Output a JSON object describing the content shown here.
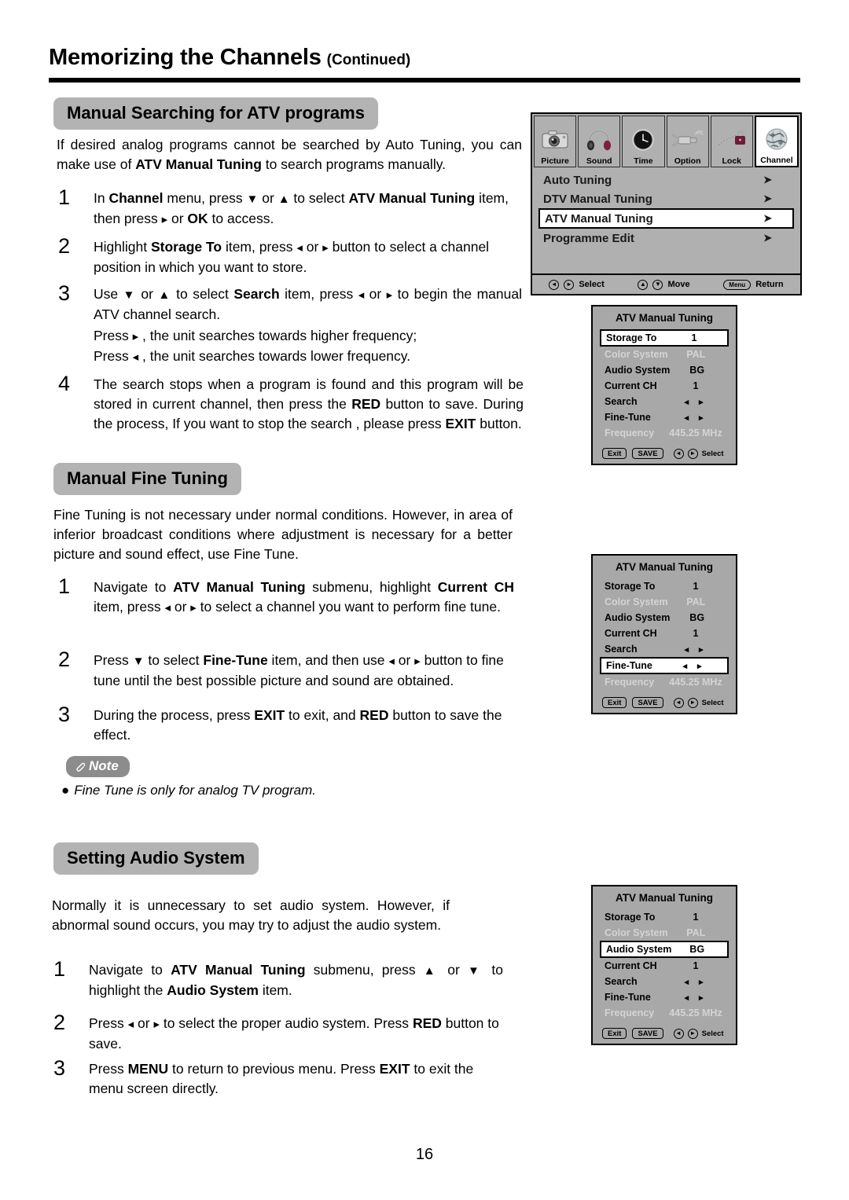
{
  "header": {
    "title": "Memorizing the Channels",
    "continued": "(Continued)"
  },
  "sections": {
    "manual_search": {
      "banner": "Manual Searching for ATV programs",
      "intro_a": "If desired analog programs cannot be searched by Auto Tuning, you can make use of ",
      "intro_b": "ATV Manual Tuning",
      "intro_c": " to search programs manually.",
      "steps": [
        {
          "num": "1",
          "t1": "In ",
          "b1": "Channel",
          "t2": " menu,  press ",
          "a1": "▼",
          "t3": " or ",
          "a2": "▲",
          "t4": " to select ",
          "b2": "ATV Manual Tuning",
          "t5": " item, then press ",
          "a3": "▸",
          "t6": " or ",
          "b3": "OK",
          "t7": " to access."
        },
        {
          "num": "2",
          "t1": "Highlight ",
          "b1": "Storage To",
          "t2": " item, press ",
          "a1": "◂",
          "t3": " or ",
          "a2": "▸",
          "t4": " button to select a channel position in which you want to store."
        },
        {
          "num": "3",
          "t1": "Use ",
          "a1": "▼",
          "t2": " or ",
          "a2": "▲",
          "t3": " to select ",
          "b1": "Search",
          "t4": " item, press ",
          "a3": "◂",
          "t5": " or ",
          "a4": "▸",
          "t6": " to begin the manual ATV channel search.",
          "l2a": "Press ",
          "l2arrow": "▸",
          "l2b": " , the unit searches towards higher frequency;",
          "l3a": "Press ",
          "l3arrow": "◂",
          "l3b": " , the unit searches towards lower frequency."
        },
        {
          "num": "4",
          "t1": "The search stops when a program is found and this program will be stored in current channel, then press the ",
          "b1": "RED",
          "t2": " button to save. During the process, If you want to stop the search , please press ",
          "b2": "EXIT",
          "t3": " button."
        }
      ]
    },
    "fine_tuning": {
      "banner": "Manual Fine Tuning",
      "intro": "Fine Tuning is not necessary under normal conditions. However, in area of inferior broadcast conditions where adjustment is necessary for a better picture and sound effect, use Fine Tune.",
      "steps": [
        {
          "num": "1",
          "t1": "Navigate to ",
          "b1": "ATV Manual Tuning",
          "t2": " submenu,  highlight ",
          "b2": "Current CH",
          "t3": " item, press ",
          "a1": "◂",
          "t4": " or ",
          "a2": "▸",
          "t5": " to select a channel you want to perform fine tune."
        },
        {
          "num": "2",
          "t1": "Press ",
          "a1": "▼",
          "t2": " to select ",
          "b1": "Fine-Tune",
          "t3": " item, and  then use ",
          "a2": "◂",
          "t4": " or ",
          "a3": "▸",
          "t5": " button to fine tune until the best possible picture and sound are obtained."
        },
        {
          "num": "3",
          "t1": "During the process, press ",
          "b1": "EXIT",
          "t2": " to exit, and ",
          "b2": "RED",
          "t3": " button to save the effect."
        }
      ],
      "note_label": "Note",
      "note_bullet": "●",
      "note_body": "Fine Tune is only for analog TV program."
    },
    "audio_system": {
      "banner": "Setting Audio System",
      "intro": "Normally it is unnecessary to set audio system. However, if abnormal sound occurs, you may try to adjust the audio system.",
      "steps": [
        {
          "num": "1",
          "t1": "Navigate to ",
          "b1": "ATV Manual Tuning",
          "t2": " submenu, press ",
          "a1": "▲",
          "t3": " or ",
          "a2": "▼",
          "t4": " to highlight the ",
          "b2": "Audio System",
          "t5": " item."
        },
        {
          "num": "2",
          "t1": "Press ",
          "a1": "◂",
          "t2": " or ",
          "a2": "▸",
          "t3": " to select the proper audio system. Press ",
          "b1": "RED",
          "t4": " button to save."
        },
        {
          "num": "3",
          "t1": "Press ",
          "b1": "MENU",
          "t2": " to return to previous menu. Press ",
          "b2": "EXIT",
          "t3": " to exit the menu screen directly."
        }
      ]
    }
  },
  "osd_main": {
    "tabs": [
      {
        "label": "Picture",
        "icon": "camera-icon",
        "active": false
      },
      {
        "label": "Sound",
        "icon": "headphones-icon",
        "active": false
      },
      {
        "label": "Time",
        "icon": "clock-icon",
        "active": false
      },
      {
        "label": "Option",
        "icon": "plug-icon",
        "active": false
      },
      {
        "label": "Lock",
        "icon": "padlock-chain-icon",
        "active": false
      },
      {
        "label": "Channel",
        "icon": "globe-icon",
        "active": true
      }
    ],
    "items": [
      {
        "label": "Auto Tuning",
        "arrow": "➤",
        "selected": false
      },
      {
        "label": "DTV Manual Tuning",
        "arrow": "➤",
        "selected": false
      },
      {
        "label": "ATV Manual Tuning",
        "arrow": "➤",
        "selected": true
      },
      {
        "label": "Programme Edit",
        "arrow": "➤",
        "selected": false
      }
    ],
    "footer": [
      {
        "key": "◂▸",
        "label": "Select",
        "type": "circles"
      },
      {
        "key": "▲▼",
        "label": "Move",
        "type": "circles"
      },
      {
        "key": "Menu",
        "label": "Return",
        "type": "pill"
      }
    ]
  },
  "osd_sub_common": {
    "title": "ATV Manual Tuning",
    "exit_label": "Exit",
    "save_label": "SAVE",
    "select_label": "Select",
    "lr_glyph": "◂ ▸",
    "rows": [
      {
        "key": "Storage To",
        "value": "1"
      },
      {
        "key": "Color System",
        "value": "PAL"
      },
      {
        "key": "Audio System",
        "value": "BG"
      },
      {
        "key": "Current CH",
        "value": "1"
      },
      {
        "key": "Search",
        "value": "◂ ▸"
      },
      {
        "key": "Fine-Tune",
        "value": "◂ ▸"
      },
      {
        "key": "Frequency",
        "value": "445.25 MHz"
      }
    ]
  },
  "osd_sub_panels": [
    {
      "id": "panel-storage-to",
      "selected_row": "Storage To",
      "dim_rows": [
        "Color System",
        "Frequency"
      ]
    },
    {
      "id": "panel-fine-tune",
      "selected_row": "Fine-Tune",
      "dim_rows": [
        "Color System",
        "Frequency"
      ]
    },
    {
      "id": "panel-audio-system",
      "selected_row": "Audio System",
      "dim_rows": [
        "Color System",
        "Frequency"
      ]
    }
  ],
  "footer": {
    "page_number": "16"
  },
  "colors": {
    "banner_gray": "#b3b3b3",
    "osd_gray": "#b0b0b0",
    "osd_sub_gray": "#a8a8a8",
    "dim_text": "#d4d4d4",
    "note_gray": "#8c8c8c"
  }
}
